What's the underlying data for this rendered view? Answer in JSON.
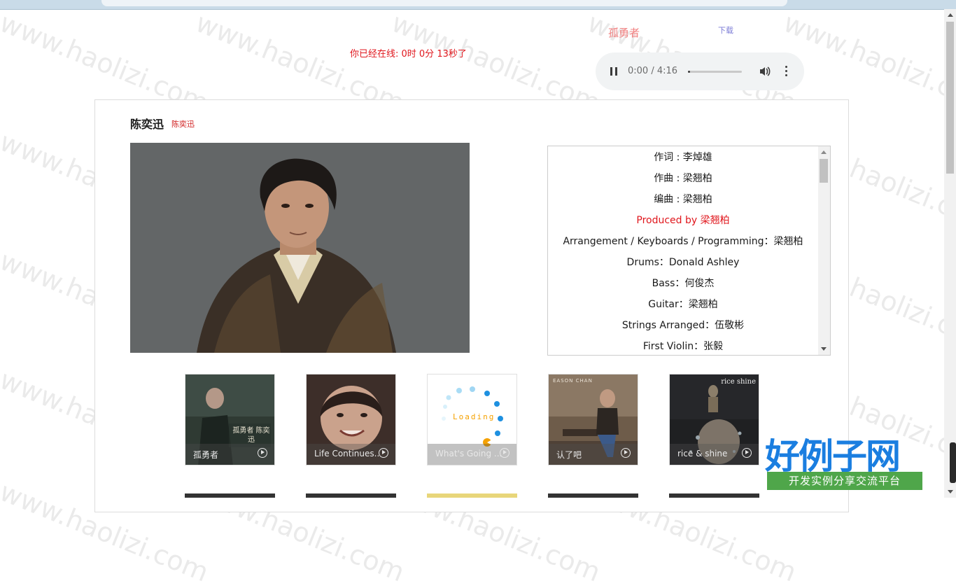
{
  "online_status": "你已经在线: 0时 0分 13秒了",
  "song_title": "孤勇者",
  "download_label": "下载",
  "player": {
    "time": "0:00 / 4:16",
    "progress_fraction": 0.02
  },
  "artist": {
    "name": "陈奕迅",
    "name_small": "陈奕迅"
  },
  "lyrics": [
    "作词 : 李焯雄",
    "作曲 : 梁翘柏",
    "编曲 : 梁翘柏",
    "Produced by 梁翘柏",
    "Arrangement / Keyboards / Programming：梁翘柏",
    "Drums：Donald Ashley",
    "Bass：何俊杰",
    "Guitar：梁翘柏",
    "Strings Arranged：伍敬彬",
    "First Violin：张毅"
  ],
  "lyrics_active_index": 3,
  "albums": [
    {
      "title": "孤勇者",
      "art": "孤勇者 陈奕迅"
    },
    {
      "title": "Life Continues...",
      "art": ""
    },
    {
      "title": "What's Going ...",
      "art": "Loading"
    },
    {
      "title": "认了吧",
      "art": "EASON CHAN"
    },
    {
      "title": "rice & shine",
      "art": "rice shine"
    }
  ],
  "watermark": {
    "text": "www.haolizi.com",
    "logo_main": "好例子网",
    "logo_sub": "开发实例分享交流平台"
  },
  "colors": {
    "accent_red": "#e0161c",
    "title_pink": "#f08080",
    "download_blue": "#7b7bd6",
    "logo_blue": "#1a7ee0",
    "logo_green": "#4fa64a"
  }
}
